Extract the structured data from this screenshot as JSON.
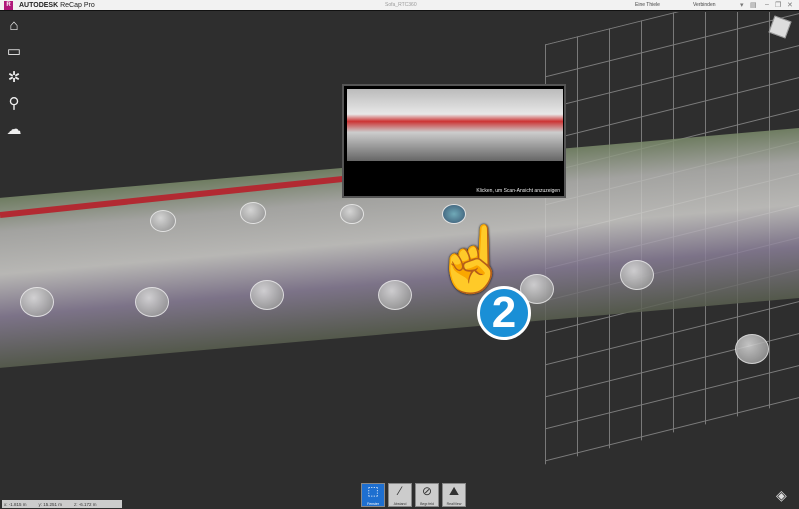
{
  "titlebar": {
    "logo_letter": "R",
    "brand": "AUTODESK",
    "product": "ReCap Pro",
    "file": "Sofa_RTC360",
    "user": "Eine Thiele",
    "connect": "Verbinden"
  },
  "sidebar": [
    {
      "icon": "home-icon",
      "glyph": "⌂"
    },
    {
      "icon": "monitor-icon",
      "glyph": "▭"
    },
    {
      "icon": "compass-icon",
      "glyph": "✲"
    },
    {
      "icon": "search-icon",
      "glyph": "⚲"
    },
    {
      "icon": "cloud-icon",
      "glyph": "☁"
    }
  ],
  "preview": {
    "caption": "Klicken, um Scan-Ansicht anzuzeigen"
  },
  "annotation": {
    "step": "2"
  },
  "coords": {
    "x": "x: -1.815 m",
    "y": "y: 15.251 m",
    "z": "z: -6.172 m"
  },
  "toolbar": [
    {
      "label": "Fenster",
      "glyph": "⬚"
    },
    {
      "label": "Abstand",
      "glyph": "⁄"
    },
    {
      "label": "Begr.feld",
      "glyph": "⊘"
    },
    {
      "label": "RealView",
      "glyph": "⛰"
    }
  ]
}
